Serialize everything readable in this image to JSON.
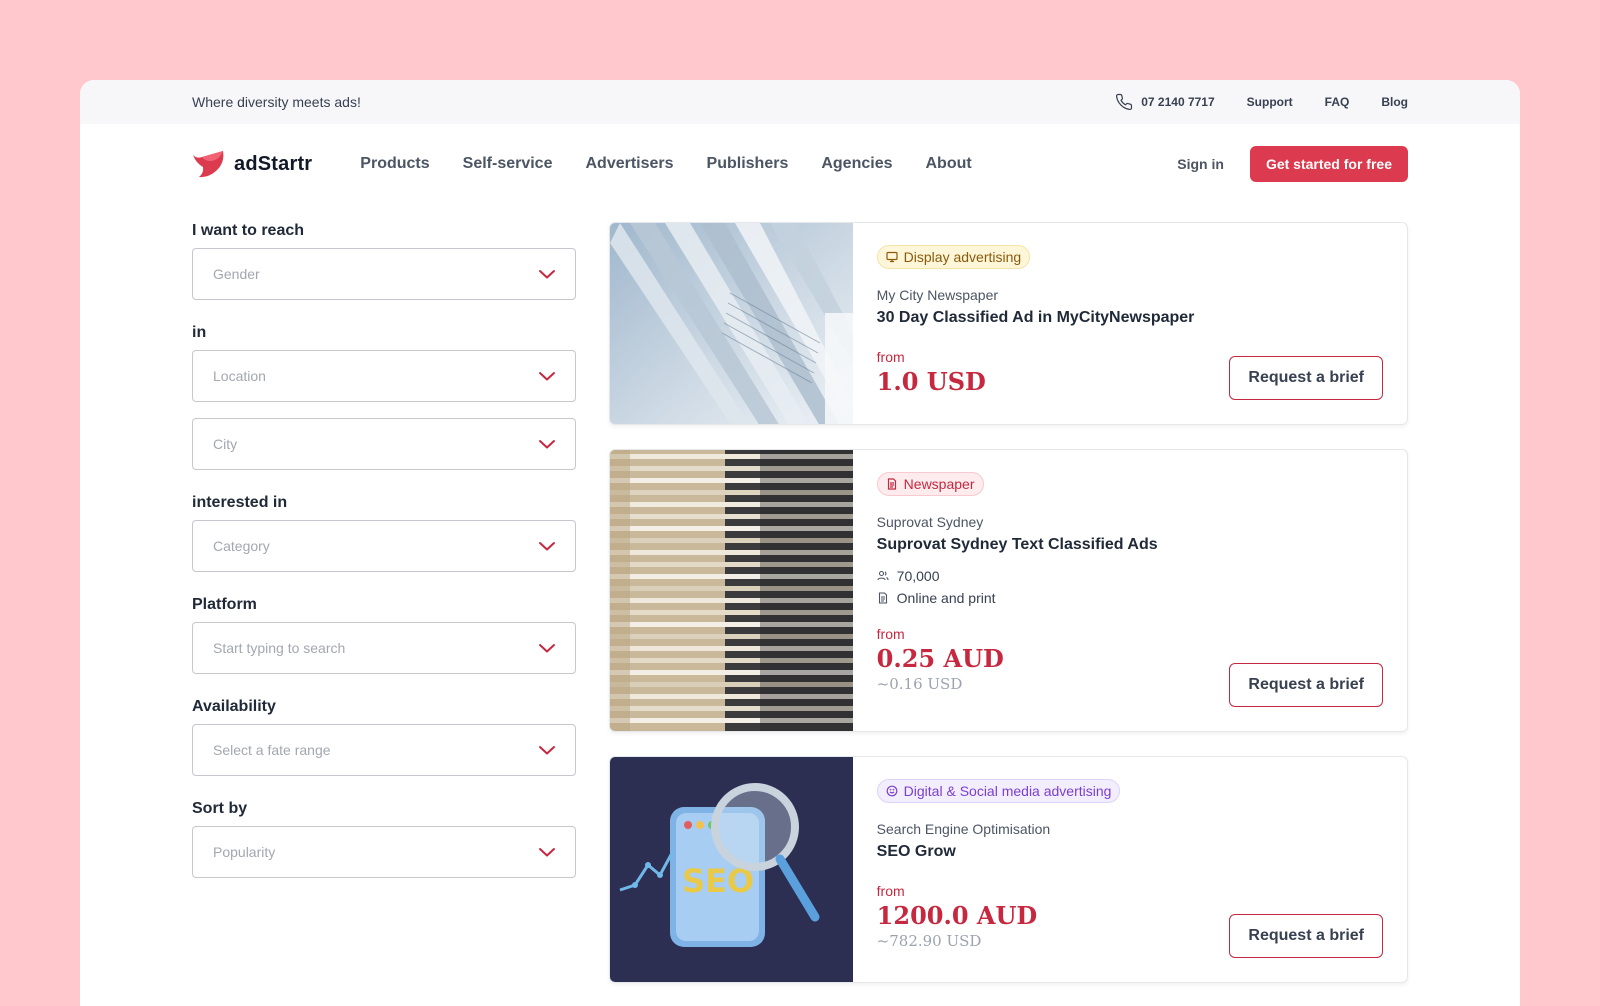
{
  "topbar": {
    "tagline": "Where diversity meets ads!",
    "phone": "07 2140 7717",
    "links": [
      "Support",
      "FAQ",
      "Blog"
    ]
  },
  "nav": {
    "brand": "adStartr",
    "menu": [
      "Products",
      "Self-service",
      "Advertisers",
      "Publishers",
      "Agencies",
      "About"
    ],
    "sign_in": "Sign in",
    "cta": "Get started for free"
  },
  "filters": {
    "reach_label": "I want to reach",
    "gender_placeholder": "Gender",
    "in_label": "in",
    "location_placeholder": "Location",
    "city_placeholder": "City",
    "interested_label": "interested in",
    "category_placeholder": "Category",
    "platform_label": "Platform",
    "platform_placeholder": "Start typing to search",
    "availability_label": "Availability",
    "availability_placeholder": "Select a fate range",
    "sort_label": "Sort by",
    "sort_placeholder": "Popularity"
  },
  "results": [
    {
      "badge": "Display advertising",
      "badge_icon": "monitor-icon",
      "badge_color": "#8A5A0B",
      "publisher": "My City Newspaper",
      "title": "30 Day Classified Ad in MyCityNewspaper",
      "from": "from",
      "price": "1.0 USD",
      "button": "Request a brief"
    },
    {
      "badge": "Newspaper",
      "badge_icon": "document-icon",
      "badge_color": "#C6283F",
      "publisher": "Suprovat Sydney",
      "title": "Suprovat Sydney Text Classified Ads",
      "audience": "70,000",
      "format": "Online and print",
      "from": "from",
      "price": "0.25 AUD",
      "price_usd": "~0.16 USD",
      "button": "Request a brief"
    },
    {
      "badge": "Digital & Social media advertising",
      "badge_icon": "smile-icon",
      "badge_color": "#7B3FD0",
      "publisher": "Search Engine Optimisation",
      "title": "SEO Grow",
      "from": "from",
      "price": "1200.0 AUD",
      "price_usd": "~782.90 USD",
      "button": "Request a brief",
      "image_text": "SEO"
    }
  ],
  "colors": {
    "background": "#FFC8CC",
    "accent": "#DC3A4E",
    "price": "#C6283F"
  }
}
